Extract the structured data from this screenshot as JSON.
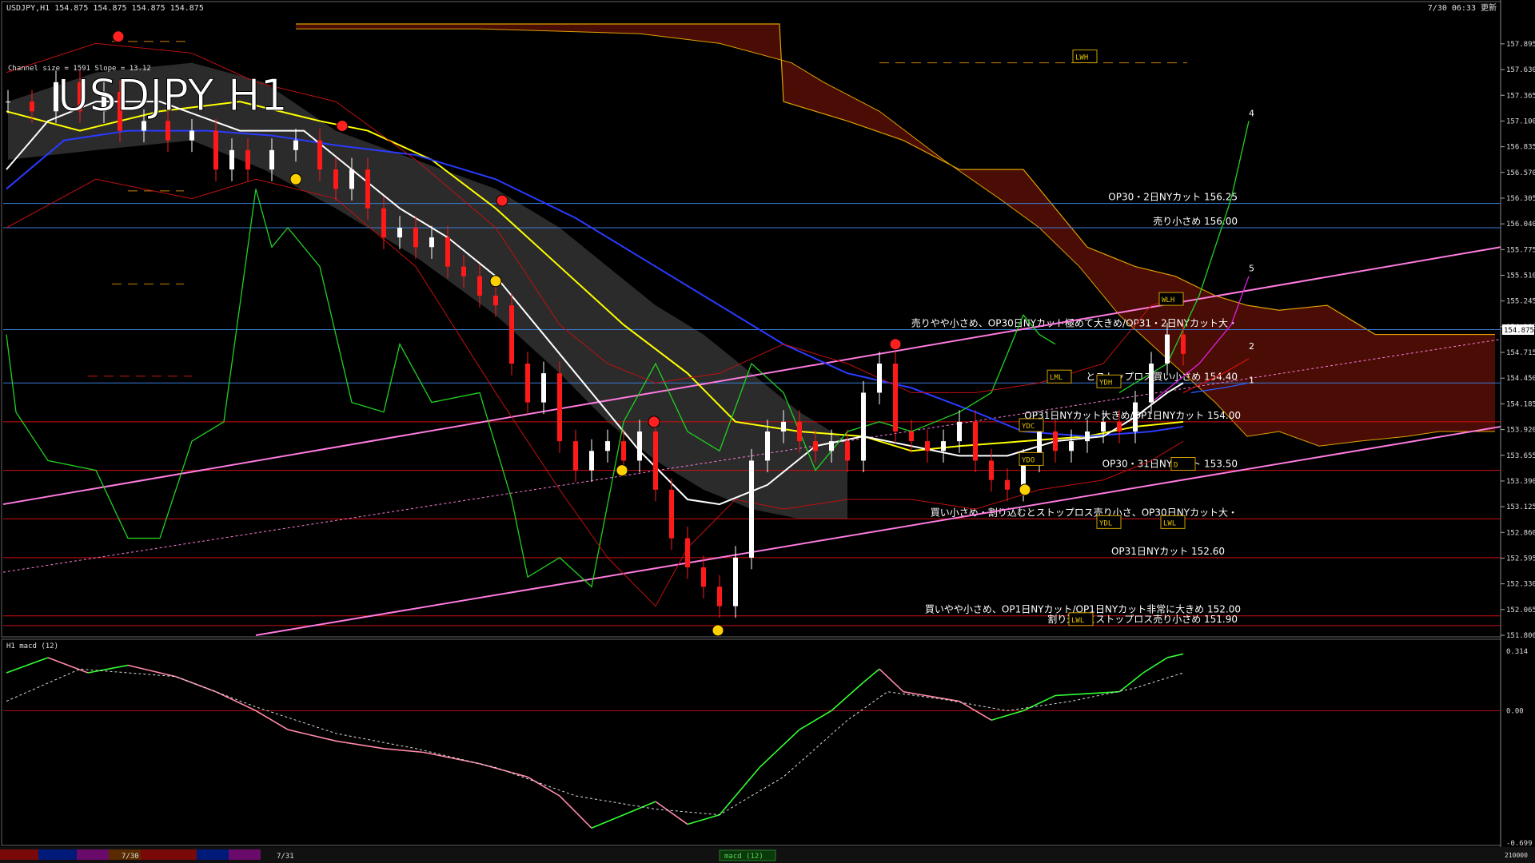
{
  "header": {
    "symbol_info": "USDJPY,H1  154.875 154.875 154.875 154.875",
    "server_time": "7/30 06:33 更新",
    "big_title": "USDJPY H1",
    "channel_info": "Channel size = 1591 Slope = 13.12"
  },
  "subwindow": {
    "label": "H1  macd (12)"
  },
  "current_price": "154.875",
  "price_axis": {
    "min": 151.8,
    "max": 158.1,
    "ticks": [
      "157.895",
      "157.630",
      "157.365",
      "157.100",
      "156.835",
      "156.570",
      "156.305",
      "156.040",
      "155.775",
      "155.510",
      "155.245",
      "154.980",
      "154.715",
      "154.450",
      "154.185",
      "153.920",
      "153.655",
      "153.390",
      "153.125",
      "152.860",
      "152.595",
      "152.330",
      "152.065",
      "151.800"
    ]
  },
  "macd_axis": {
    "ticks": [
      "0.314",
      "0.00",
      "-0.699"
    ],
    "min": -0.699,
    "max": 0.314
  },
  "levels": [
    {
      "label": "OP30・2日NYカット 156.25",
      "price": 156.25,
      "color": "#3a7bd5"
    },
    {
      "label": "売り小さめ 156.00",
      "price": 156.0,
      "color": "#3a7bd5"
    },
    {
      "label": "売りやや小さめ、OP30日NYカット極めて大きめ/OP31・2日NYカット大・",
      "price": 154.95,
      "color": "#3a7bd5"
    },
    {
      "label": "とストップロス買い小さめ 154.40",
      "price": 154.4,
      "color": "#3a7bd5"
    },
    {
      "label": "OP31日NYカット大きめ/OP1日NYカット 154.00",
      "price": 154.0,
      "color": "#d01010"
    },
    {
      "label": "OP30・31日NYカット 153.50",
      "price": 153.5,
      "color": "#d01010"
    },
    {
      "label": "買い小さめ・割り込むとストップロス売り小さ、OP30日NYカット大・",
      "price": 153.0,
      "color": "#d01010"
    },
    {
      "label": "OP31日NYカット 152.60",
      "price": 152.6,
      "color": "#d01010"
    },
    {
      "label": "買いやや小さめ、OP1日NYカット/OP1日NYカット非常に大きめ 152.00",
      "price": 152.0,
      "color": "#d01010"
    },
    {
      "label": "割り込むとストップロス売り小さめ 151.90",
      "price": 151.9,
      "color": "#d01010"
    }
  ],
  "boxes": [
    {
      "label": "LWH",
      "price": 157.75
    },
    {
      "label": "WLH",
      "price": 155.25
    },
    {
      "label": "LML",
      "price": 154.45
    },
    {
      "label": "YDH",
      "price": 154.4
    },
    {
      "label": "YDC",
      "price": 153.95
    },
    {
      "label": "YDO",
      "price": 153.6
    },
    {
      "label": "D",
      "price": 153.55
    },
    {
      "label": "YDL",
      "price": 152.95
    },
    {
      "label": "LWL",
      "price": 152.95
    },
    {
      "label": "LWL",
      "price": 151.95
    }
  ],
  "wave_labels": [
    "4",
    "5",
    "2",
    "1"
  ],
  "time_axis": {
    "labels": [
      "7/30",
      "7/31"
    ]
  },
  "bottom_tab": "macd (12)",
  "volume_label": "210000",
  "colors": {
    "bg": "#000000",
    "bull": "#ffffff",
    "bear": "#ff1a1a",
    "cloud": "#ff3300",
    "kijun": "#ffff00",
    "ma_blue": "#2a3bff",
    "ma_white": "#ffffff",
    "channel": "#ff7be0",
    "macd_green": "#33ff33",
    "macd_pink": "#ff8aa8"
  }
}
